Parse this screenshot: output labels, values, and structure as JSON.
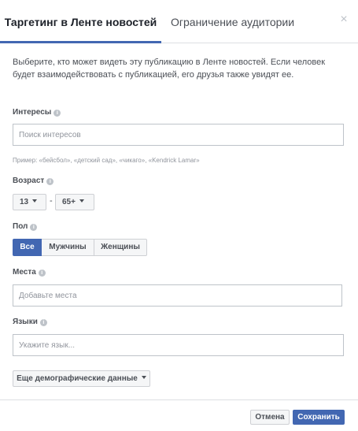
{
  "tabs": {
    "active_label": "Таргетинг в Ленте новостей",
    "inactive_label": "Ограничение аудитории",
    "close_glyph": "×"
  },
  "description": "Выберите, кто может видеть эту публикацию в Ленте новостей. Если человек будет взаимодействовать с публикацией, его друзья также увидят ее.",
  "interests": {
    "label": "Интересы",
    "placeholder": "Поиск интересов",
    "value": "",
    "hint": "Пример: «бейсбол», «детский сад», «чикаго», «Kendrick Lamar»"
  },
  "age": {
    "label": "Возраст",
    "min": "13",
    "separator": "-",
    "max": "65+"
  },
  "gender": {
    "label": "Пол",
    "options": [
      "Все",
      "Мужчины",
      "Женщины"
    ],
    "selected": "Все"
  },
  "locations": {
    "label": "Места",
    "placeholder": "Добавьте места",
    "value": ""
  },
  "languages": {
    "label": "Языки",
    "placeholder": "Укажите язык...",
    "value": ""
  },
  "more_demographics_label": "Еще демографические данные",
  "footer": {
    "cancel_label": "Отмена",
    "save_label": "Сохранить"
  },
  "colors": {
    "accent": "#4267b2",
    "border": "#ced0d4",
    "text": "#1d2129",
    "muted": "#90949c"
  },
  "icons": {
    "info": "info-icon",
    "close": "close-icon",
    "caret": "caret-down-icon"
  }
}
